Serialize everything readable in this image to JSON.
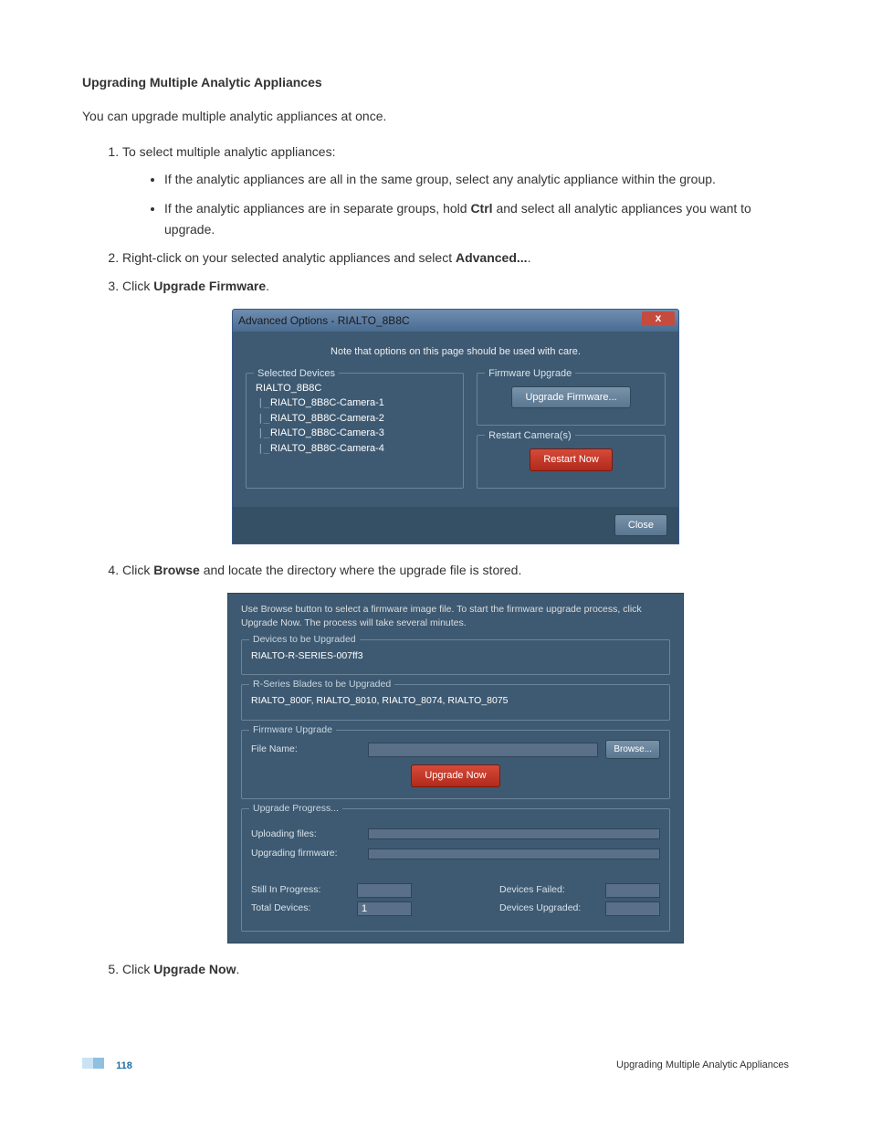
{
  "heading": "Upgrading Multiple Analytic Appliances",
  "intro": "You can upgrade multiple analytic appliances at once.",
  "ol": {
    "i1": "To select multiple analytic appliances:",
    "i1a": "If the analytic appliances are all in the same group, select any analytic appliance within the group.",
    "i1b_pre": "If the analytic appliances are in separate groups, hold ",
    "i1b_bold": "Ctrl",
    "i1b_post": " and select all analytic appliances you want to upgrade.",
    "i2_pre": "Right-click on your selected analytic appliances and select ",
    "i2_bold": "Advanced...",
    "i2_post": ".",
    "i3_pre": "Click ",
    "i3_bold": "Upgrade Firmware",
    "i3_post": ".",
    "i4_pre": "Click ",
    "i4_bold": "Browse",
    "i4_post": " and locate the directory where the upgrade file is stored.",
    "i5_pre": "Click ",
    "i5_bold": "Upgrade Now",
    "i5_post": "."
  },
  "shot1": {
    "title": "Advanced Options - RIALTO_8B8C",
    "close_glyph": "x",
    "note": "Note that options on this page should be used with care.",
    "selected_legend": "Selected Devices",
    "dev_root": "RIALTO_8B8C",
    "dev1": "RIALTO_8B8C-Camera-1",
    "dev2": "RIALTO_8B8C-Camera-2",
    "dev3": "RIALTO_8B8C-Camera-3",
    "dev4": "RIALTO_8B8C-Camera-4",
    "fw_legend": "Firmware Upgrade",
    "fw_btn": "Upgrade Firmware...",
    "restart_legend": "Restart Camera(s)",
    "restart_btn": "Restart Now",
    "close_btn": "Close"
  },
  "shot2": {
    "instruction": "Use Browse button to select a firmware image file.  To start the firmware upgrade process, click Upgrade Now.  The process will take several minutes.",
    "devices_legend": "Devices to be Upgraded",
    "devices_content": "RIALTO-R-SERIES-007ff3",
    "blades_legend": "R-Series Blades to be Upgraded",
    "blades_content": "RIALTO_800F, RIALTO_8010, RIALTO_8074, RIALTO_8075",
    "fw_legend": "Firmware Upgrade",
    "file_label": "File Name:",
    "browse_btn": "Browse...",
    "upgrade_now_btn": "Upgrade Now",
    "progress_legend": "Upgrade Progress...",
    "uploading_label": "Uploading files:",
    "upgrading_label": "Upgrading firmware:",
    "still_label": "Still In Progress:",
    "total_label": "Total Devices:",
    "total_value": "1",
    "failed_label": "Devices Failed:",
    "upgraded_label": "Devices Upgraded:"
  },
  "footer": {
    "page_number": "118",
    "section": "Upgrading Multiple Analytic Appliances"
  }
}
